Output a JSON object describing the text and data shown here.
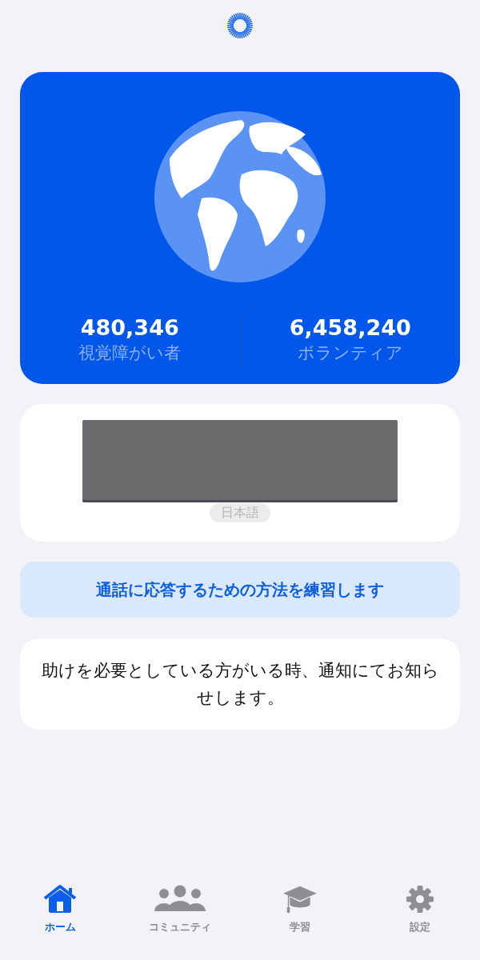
{
  "stats": [
    {
      "value": "480,346",
      "label": "視覚障がい者"
    },
    {
      "value": "6,458,240",
      "label": "ボランティア"
    }
  ],
  "language_chip": "日本語",
  "practice_button": "通話に応答するための方法を練習します",
  "notice": "助けを必要としている方がいる時、通知にてお知らせします。",
  "tabs": [
    {
      "kind": "home",
      "label": "ホーム",
      "selected": true
    },
    {
      "kind": "community",
      "label": "コミュニティ",
      "selected": false
    },
    {
      "kind": "learn",
      "label": "学習",
      "selected": false
    },
    {
      "kind": "settings",
      "label": "設定",
      "selected": false
    }
  ]
}
